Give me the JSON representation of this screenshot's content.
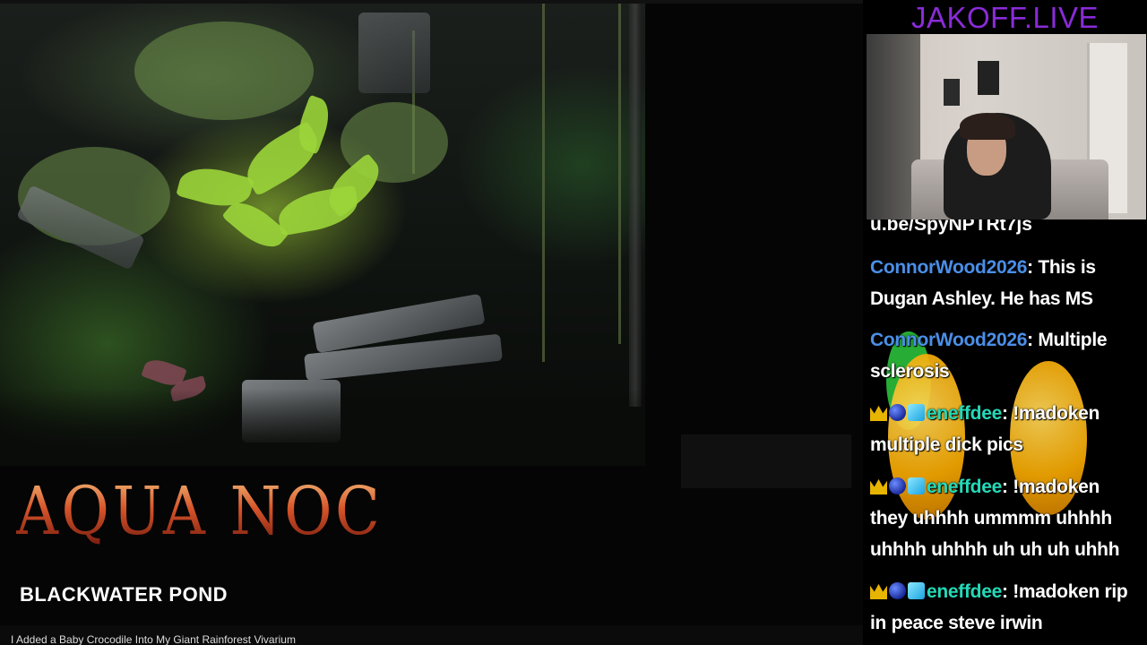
{
  "video": {
    "title_main": "Aqua Noctis",
    "title_sub": "BLACKWATER POND",
    "caption": "I Added a Baby Crocodile Into My Giant Rainforest Vivarium"
  },
  "panel": {
    "brand": "JAKOFF.LIVE"
  },
  "chat": {
    "cutoff_text": "u.be/SpyNPTRt7js",
    "messages": [
      {
        "user": "ConnorWood2026",
        "text": "This is Dugan Ashley. He has MS",
        "badges": []
      },
      {
        "user": "ConnorWood2026",
        "text": "Multiple sclerosis",
        "badges": []
      },
      {
        "user": "eneffdee",
        "text": "!madoken multiple dick pics",
        "badges": [
          "crown-icon",
          "orb-icon",
          "cube-icon"
        ]
      },
      {
        "user": "eneffdee",
        "text": "!madoken they uhhhh ummmm uhhhh uhhhh uhhhh uh uh uh uhhh",
        "badges": [
          "crown-icon",
          "orb-icon",
          "cube-icon"
        ]
      },
      {
        "user": "eneffdee",
        "text": "!madoken rip in peace steve irwin",
        "badges": [
          "crown-icon",
          "orb-icon",
          "cube-icon"
        ]
      }
    ]
  },
  "colors": {
    "brand": "#8a2bd8",
    "user_blue": "#4a8fe8",
    "user_teal": "#25d9b8"
  }
}
